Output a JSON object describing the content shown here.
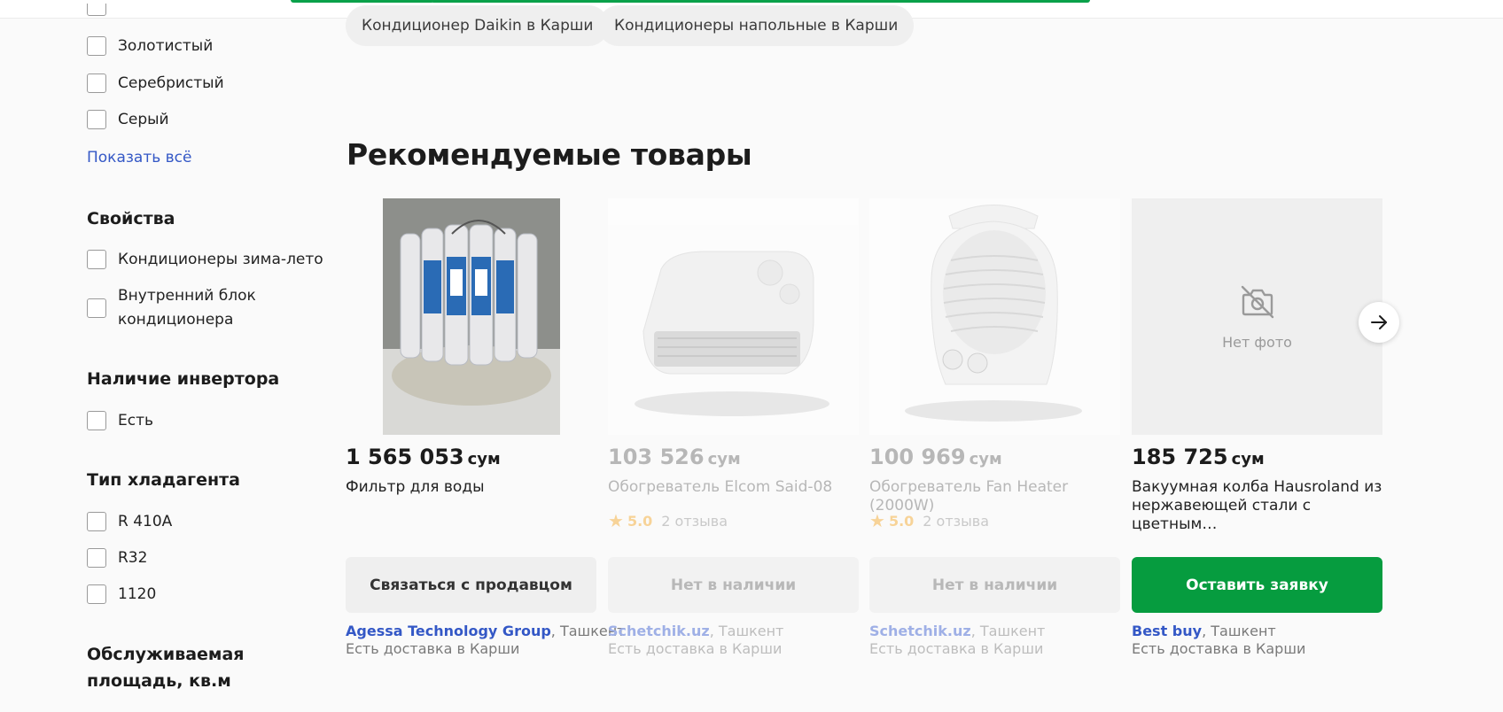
{
  "chips": [
    "Кондиционер Daikin в Карши",
    "Кондиционеры напольные в Карши"
  ],
  "sidebar": {
    "colors": [
      "Золотистый",
      "Серебристый",
      "Серый"
    ],
    "show_all": "Показать всё",
    "groups": [
      {
        "title": "Свойства",
        "options": [
          "Кондиционеры зима-лето",
          "Внутренний блок кондиционера"
        ]
      },
      {
        "title": "Наличие инвертора",
        "options": [
          "Есть"
        ]
      },
      {
        "title": "Тип хладагента",
        "options": [
          "R 410A",
          "R32",
          "1120"
        ]
      },
      {
        "title": "Обслуживаемая площадь, кв.м",
        "options": []
      }
    ]
  },
  "section_title": "Рекомендуемые товары",
  "products": [
    {
      "price": "1 565 053",
      "currency": "сум",
      "title": "Фильтр для воды",
      "rating": null,
      "reviews": null,
      "button": "Связаться с продавцом",
      "seller": "Agessa Technology Group",
      "city": "Ташкент",
      "delivery": "Есть доставка в Карши",
      "image": "water-filter-image"
    },
    {
      "price": "103 526",
      "currency": "сум",
      "title": "Обогреватель Elcom Said-08",
      "rating": "5.0",
      "reviews": "2 отзыва",
      "button": "Нет в наличии",
      "seller": "Schetchik.uz",
      "city": "Ташкент",
      "delivery": "Есть доставка в Карши",
      "image": "heater-image"
    },
    {
      "price": "100 969",
      "currency": "сум",
      "title": "Обогреватель Fan Heater (2000W)",
      "rating": "5.0",
      "reviews": "2 отзыва",
      "button": "Нет в наличии",
      "seller": "Schetchik.uz",
      "city": "Ташкент",
      "delivery": "Есть доставка в Карши",
      "image": "fan-heater-image"
    },
    {
      "price": "185 725",
      "currency": "сум",
      "title": "Вакуумная колба Hausroland из нержавеющей стали с цветным…",
      "rating": null,
      "reviews": null,
      "button": "Оставить заявку",
      "seller": "Best buy",
      "city": "Ташкент",
      "delivery": "Есть доставка в Карши",
      "image": "no-photo",
      "no_photo_label": "Нет фото"
    }
  ],
  "colors": {
    "accent_green": "#069c3f",
    "link_blue": "#3458c6",
    "star": "#f5a623"
  }
}
